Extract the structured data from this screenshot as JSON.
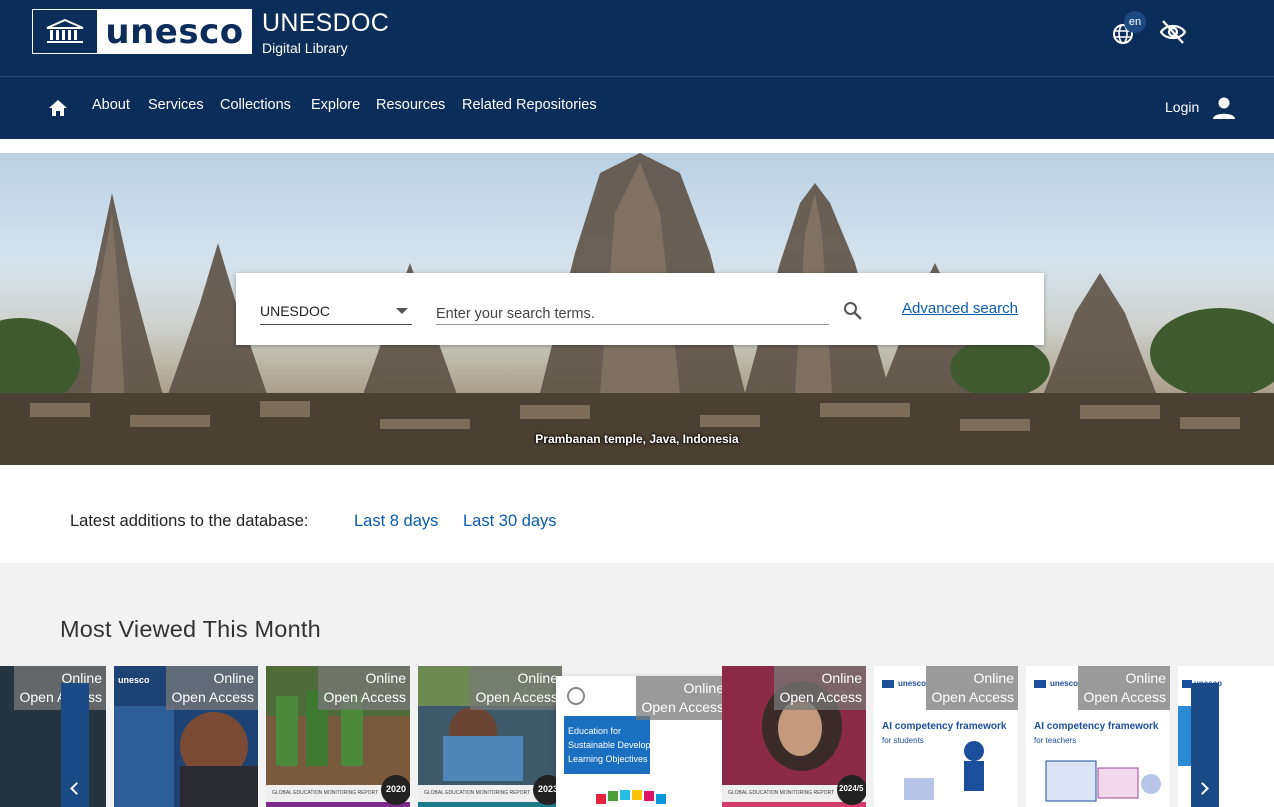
{
  "header": {
    "logo_word": "unesco",
    "site_title": "UNESDOC",
    "site_subtitle": "Digital Library",
    "language_badge": "en",
    "icons": [
      "unesco-temple-icon",
      "language-globe-icon",
      "visibility-off-icon"
    ]
  },
  "nav": {
    "items": [
      "About",
      "Services",
      "Collections",
      "Explore",
      "Resources",
      "Related Repositories"
    ],
    "login_label": "Login",
    "icons": [
      "home-icon",
      "person-icon"
    ]
  },
  "hero": {
    "caption": "Prambanan temple, Java, Indonesia"
  },
  "search": {
    "database_selected": "UNESDOC",
    "placeholder": "Enter your search terms.",
    "advanced_label": "Advanced search",
    "icons": [
      "search-icon",
      "chevron-down-icon"
    ]
  },
  "latest": {
    "label": "Latest additions to the database:",
    "links": [
      "Last 8 days",
      "Last 30 days"
    ]
  },
  "most_viewed": {
    "title": "Most Viewed This Month",
    "badge_line1": "Online",
    "badge_line2": "Open Access",
    "cards": [
      {
        "title": "",
        "cover_text": []
      },
      {
        "title": "",
        "cover_text": [
          "unesco"
        ]
      },
      {
        "title": "",
        "cover_text": [
          "GLOBAL EDUCATION MONITORING REPORT",
          "2020"
        ]
      },
      {
        "title": "",
        "cover_text": [
          "GLOBAL EDUCATION MONITORING REPORT",
          "2023"
        ]
      },
      {
        "title": "",
        "cover_text": [
          "Education for",
          "Sustainable Development Goals",
          "Learning Objectives"
        ]
      },
      {
        "title": "",
        "cover_text": [
          "GLOBAL EDUCATION MONITORING REPORT",
          "2024/5"
        ]
      },
      {
        "title": "",
        "cover_text": [
          "unesco",
          "AI competency framework",
          "for students"
        ]
      },
      {
        "title": "",
        "cover_text": [
          "unesco",
          "AI competency framework",
          "for teachers"
        ]
      },
      {
        "title": "",
        "cover_text": [
          "unesco"
        ]
      }
    ],
    "icons": [
      "chevron-left-icon",
      "chevron-right-icon"
    ]
  },
  "colors": {
    "header_bg": "#0c2d5a",
    "link": "#0b5cad",
    "carousel_arrow": "#1a4b86",
    "section_bg": "#f2f2f2"
  }
}
